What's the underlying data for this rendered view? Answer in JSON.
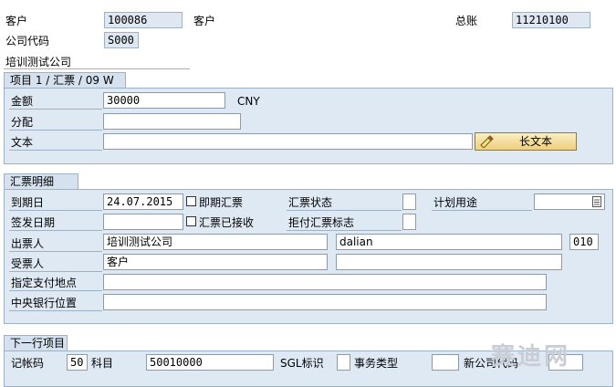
{
  "header": {
    "customer_label": "客户",
    "customer_value": "100086",
    "customer_text": "客户",
    "ledger_label": "总账",
    "ledger_value": "11210100",
    "company_label": "公司代码",
    "company_value": "S000",
    "company_name": "培训测试公司"
  },
  "item_section": {
    "title": "项目 1 / 汇票 / 09 W",
    "amount_label": "金额",
    "amount_value": "30000",
    "currency": "CNY",
    "assignment_label": "分配",
    "assignment_value": "",
    "text_label": "文本",
    "text_value": "",
    "long_text_button": "长文本"
  },
  "bill_section": {
    "title": "汇票明细",
    "due_date_label": "到期日",
    "due_date_value": "24.07.2015",
    "instant_bill_label": "即期汇票",
    "bill_status_label": "汇票状态",
    "plan_usage_label": "计划用途",
    "issue_date_label": "签发日期",
    "issue_date_value": "",
    "bill_received_label": "汇票已接收",
    "refused_flag_label": "拒付汇票标志",
    "drawer_label": "出票人",
    "drawer_name": "培训测试公司",
    "drawer_city": "dalian",
    "drawer_code": "010",
    "payee_label": "受票人",
    "payee_name": "客户",
    "payee_city": "",
    "payment_place_label": "指定支付地点",
    "payment_place_value": "",
    "central_bank_label": "中央银行位置",
    "central_bank_value": ""
  },
  "next_section": {
    "title": "下一行项目",
    "posting_key_label": "记帐码",
    "posting_key_value": "50",
    "account_label": "科目",
    "account_value": "50010000",
    "sgl_label": "SGL标识",
    "trans_type_label": "事务类型",
    "new_company_label": "新公司代码"
  },
  "watermark": "赛迪网"
}
